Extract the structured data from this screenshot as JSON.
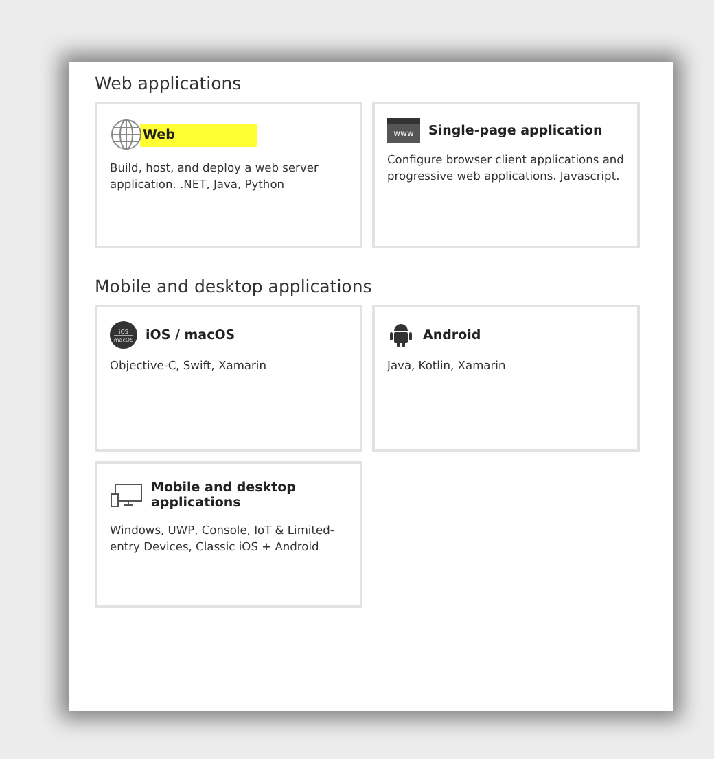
{
  "sections": [
    {
      "title": "Web applications",
      "cards": [
        {
          "kind": "globe",
          "title": "Web",
          "description": "Build, host, and deploy a web server application. .NET, Java, Python",
          "highlighted": true
        },
        {
          "kind": "www",
          "icon_text": [
            "www"
          ],
          "title": "Single-page application",
          "description": "Configure browser client applications and progressive web applications. Javascript.",
          "highlighted": false
        }
      ]
    },
    {
      "title": "Mobile and desktop applications",
      "cards": [
        {
          "kind": "ios",
          "icon_text": [
            "iOS",
            "macOS"
          ],
          "title": "iOS / macOS",
          "description": "Objective-C, Swift, Xamarin",
          "highlighted": false
        },
        {
          "kind": "android",
          "title": "Android",
          "description": "Java, Kotlin, Xamarin",
          "highlighted": false
        },
        {
          "kind": "desktop",
          "title": "Mobile and desktop applications",
          "description": "Windows, UWP, Console, IoT & Limited-entry Devices, Classic iOS + Android",
          "highlighted": false
        }
      ]
    }
  ]
}
